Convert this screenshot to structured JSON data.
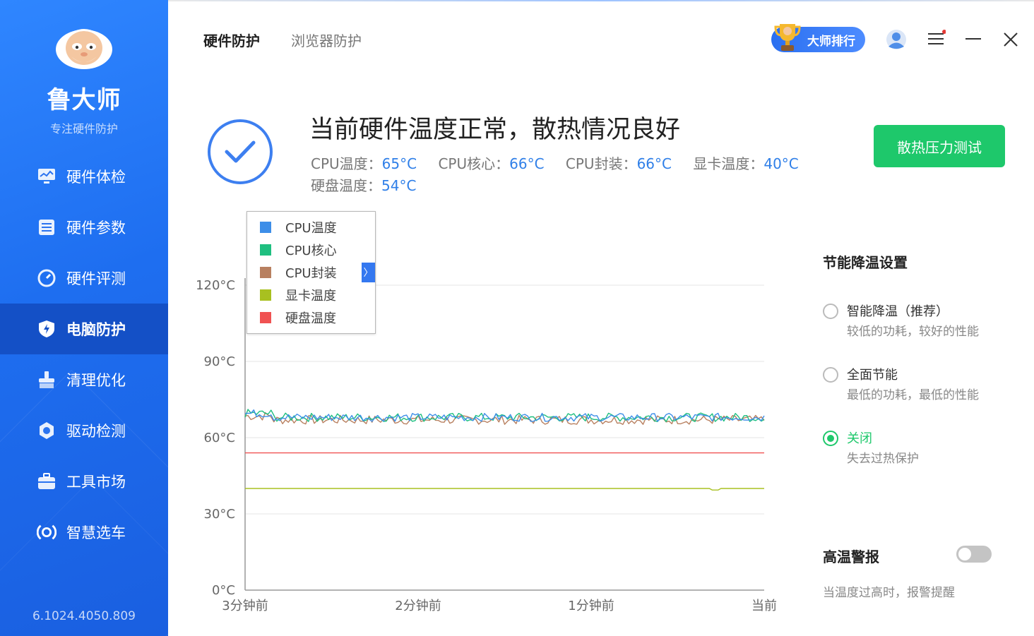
{
  "sidebar": {
    "brand": "鲁大师",
    "slogan": "专注硬件防护",
    "items": [
      {
        "label": "硬件体检",
        "icon": "monitor-icon"
      },
      {
        "label": "硬件参数",
        "icon": "list-icon"
      },
      {
        "label": "硬件评测",
        "icon": "gauge-icon"
      },
      {
        "label": "电脑防护",
        "icon": "shield-icon",
        "active": true
      },
      {
        "label": "清理优化",
        "icon": "broom-icon"
      },
      {
        "label": "驱动检测",
        "icon": "gear-icon"
      },
      {
        "label": "工具市场",
        "icon": "toolbox-icon"
      },
      {
        "label": "智慧选车",
        "icon": "car-icon"
      }
    ],
    "version": "6.1024.4050.809"
  },
  "header": {
    "tabs": [
      {
        "label": "硬件防护",
        "active": true
      },
      {
        "label": "浏览器防护",
        "active": false
      }
    ],
    "rank_label": "大师排行"
  },
  "status": {
    "title": "当前硬件温度正常，散热情况良好",
    "temps": [
      {
        "label": "CPU温度：",
        "value": "65°C"
      },
      {
        "label": "CPU核心：",
        "value": "66°C"
      },
      {
        "label": "CPU封装：",
        "value": "66°C"
      },
      {
        "label": "显卡温度：",
        "value": "40°C"
      },
      {
        "label": "硬盘温度：",
        "value": "54°C"
      }
    ],
    "stress_button": "散热压力测试"
  },
  "settings": {
    "title": "节能降温设置",
    "options": [
      {
        "title": "智能降温（推荐）",
        "desc": "较低的功耗，较好的性能",
        "selected": false
      },
      {
        "title": "全面节能",
        "desc": "最低的功耗，最低的性能",
        "selected": false
      },
      {
        "title": "关闭",
        "desc": "失去过热保护",
        "selected": true
      }
    ],
    "alert_title": "高温警报",
    "alert_desc": "当温度过高时，报警提醒",
    "alert_enabled": false
  },
  "colors": {
    "accent_blue": "#2f7fe8",
    "green": "#1ec86b",
    "sidebar_active": "#1450c6"
  },
  "chart_data": {
    "type": "line",
    "yticks": [
      "120°C",
      "90°C",
      "60°C",
      "30°C",
      "0°C"
    ],
    "ylim": [
      0,
      120
    ],
    "xticks": [
      "3分钟前",
      "2分钟前",
      "1分钟前",
      "当前"
    ],
    "legend_placement": "top-left",
    "series": [
      {
        "name": "CPU温度",
        "color": "#3d8ee8",
        "approx_value": 68,
        "noise": 1.6
      },
      {
        "name": "CPU核心",
        "color": "#1fbf80",
        "approx_value": 68,
        "noise": 1.7
      },
      {
        "name": "CPU封装",
        "color": "#b88060",
        "approx_value": 67,
        "noise": 1.8
      },
      {
        "name": "显卡温度",
        "color": "#a8c020",
        "approx_value": 40,
        "noise": 0
      },
      {
        "name": "硬盘温度",
        "color": "#f05252",
        "approx_value": 54,
        "noise": 0
      }
    ]
  }
}
